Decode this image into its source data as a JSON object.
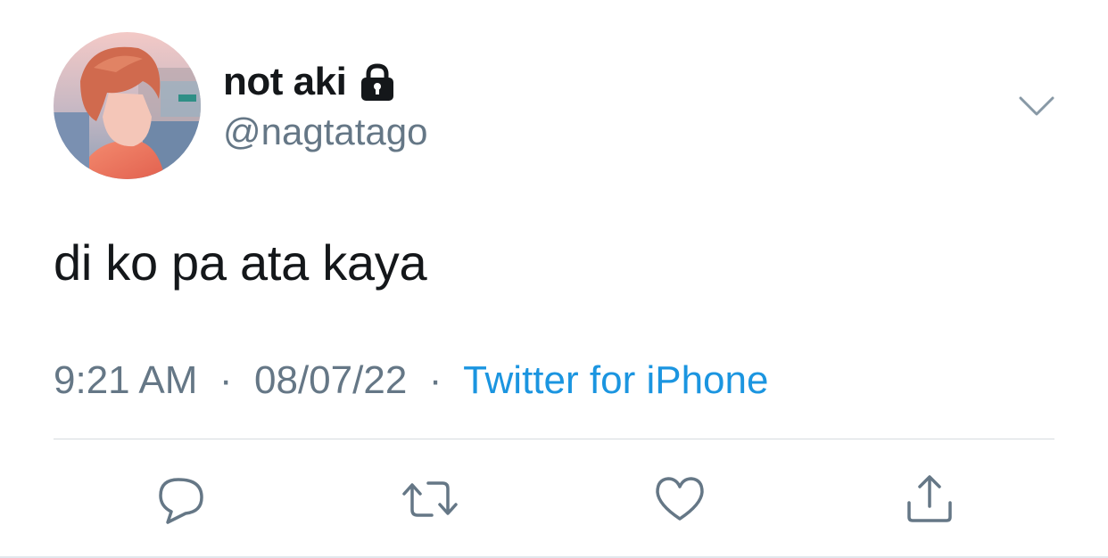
{
  "tweet": {
    "author": {
      "display_name": "not aki",
      "handle": "@nagtatago",
      "avatar_icon": "profile-photo",
      "protected_icon": "lock-icon"
    },
    "text": "di ko pa ata kaya",
    "time": "9:21 AM",
    "date": "08/07/22",
    "separator": "·",
    "source": "Twitter for iPhone"
  },
  "colors": {
    "text_primary": "#14171a",
    "text_secondary": "#657786",
    "link": "#1b95e0",
    "divider": "#d6dbdf"
  },
  "actions": [
    {
      "name": "reply",
      "icon": "reply-icon"
    },
    {
      "name": "retweet",
      "icon": "retweet-icon"
    },
    {
      "name": "like",
      "icon": "heart-icon"
    },
    {
      "name": "share",
      "icon": "share-icon"
    }
  ],
  "menu": {
    "icon": "chevron-down-icon"
  }
}
